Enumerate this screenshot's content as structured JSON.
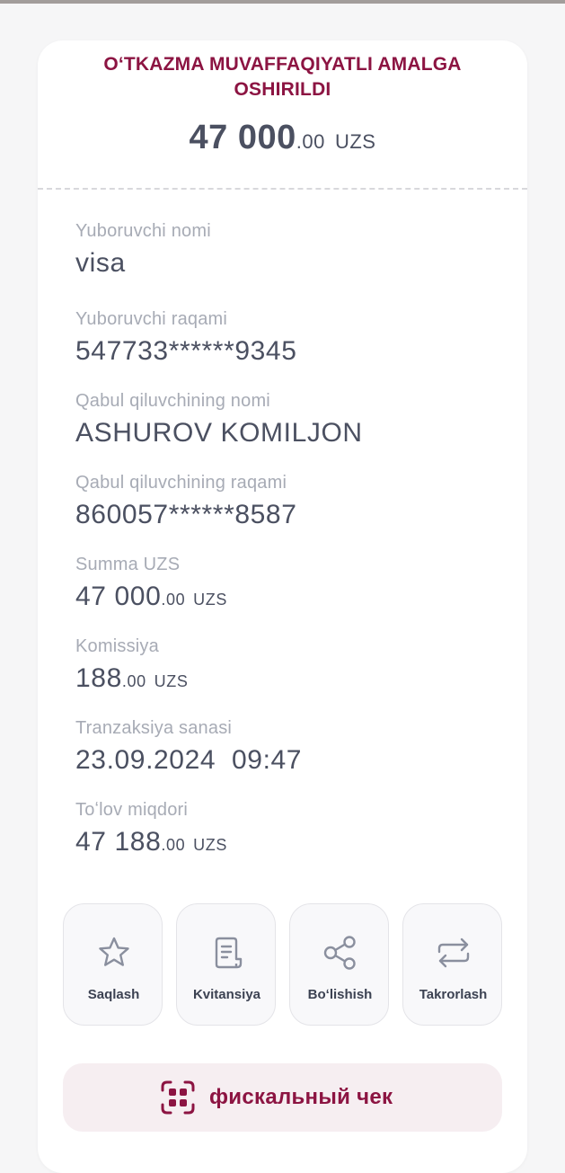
{
  "header": {
    "title": "OʻTKAZMA MUVAFFAQIYATLI AMALGA OSHIRILDI",
    "amount_int": "47 000",
    "amount_dec": ".00",
    "amount_cur": "UZS"
  },
  "fields": {
    "sender_name_label": "Yuboruvchi nomi",
    "sender_name_value": "visa",
    "sender_number_label": "Yuboruvchi raqami",
    "sender_number_value": "547733******9345",
    "receiver_name_label": "Qabul qiluvchining nomi",
    "receiver_name_value": "ASHUROV KOMILJON",
    "receiver_number_label": "Qabul qiluvchining raqami",
    "receiver_number_value": "860057******8587",
    "sum_label": "Summa UZS",
    "sum_int": "47 000",
    "sum_dec": ".00",
    "sum_cur": "UZS",
    "fee_label": "Komissiya",
    "fee_int": "188",
    "fee_dec": ".00",
    "fee_cur": "UZS",
    "date_label": "Tranzaksiya sanasi",
    "date_value": "23.09.2024  09:47",
    "total_label": "Toʻlov miqdori",
    "total_int": "47 188",
    "total_dec": ".00",
    "total_cur": "UZS"
  },
  "actions": [
    {
      "label": "Saqlash",
      "icon": "star-icon"
    },
    {
      "label": "Kvitansiya",
      "icon": "receipt-icon"
    },
    {
      "label": "Boʻlishish",
      "icon": "share-icon"
    },
    {
      "label": "Takrorlash",
      "icon": "repeat-icon"
    }
  ],
  "fiscal": {
    "label": "фискальный чек",
    "icon": "qr-scan-icon"
  },
  "colors": {
    "accent": "#8c1442",
    "text": "#4b5061",
    "label": "#a7abb5"
  }
}
